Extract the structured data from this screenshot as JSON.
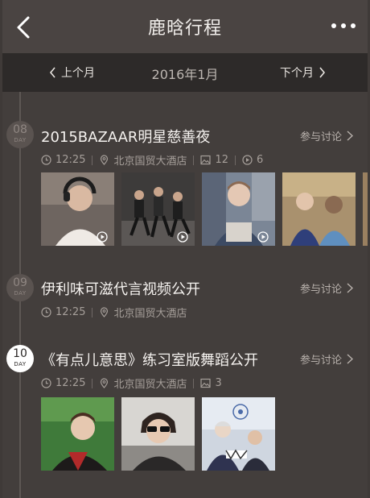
{
  "header": {
    "title": "鹿晗行程",
    "back_icon": "chevron-left-icon",
    "more_icon": "more-dots-icon"
  },
  "month_nav": {
    "prev_label": "上个月",
    "current": "2016年1月",
    "next_label": "下个月"
  },
  "colors": {
    "background": "#433e3c",
    "titlebar": "#4a4442",
    "monthbar": "#2d2a29",
    "text_muted": "#a69f9a"
  },
  "events": [
    {
      "day": "08",
      "day_label": "DAY",
      "title": "2015BAZAAR明星慈善夜",
      "discuss": "参与讨论",
      "time": "12:25",
      "location": "北京国贸大酒店",
      "image_count": "12",
      "video_count": "6",
      "photos": [
        {
          "subject": "person-with-headphones",
          "video": true
        },
        {
          "subject": "group-dancing",
          "video": true
        },
        {
          "subject": "person-in-store",
          "video": true
        },
        {
          "subject": "two-people-in-shop",
          "video": false
        }
      ]
    },
    {
      "day": "09",
      "day_label": "DAY",
      "title": "伊利味可滋代言视频公开",
      "discuss": "参与讨论",
      "time": "12:25",
      "location": "北京国贸大酒店"
    },
    {
      "day": "10",
      "day_label": "DAY",
      "title": "《有点儿意思》练习室版舞蹈公开",
      "discuss": "参与讨论",
      "time": "12:25",
      "location": "北京国贸大酒店",
      "image_count": "3",
      "photos": [
        {
          "subject": "person-on-grass",
          "video": false
        },
        {
          "subject": "person-with-sunglasses",
          "video": false
        },
        {
          "subject": "people-at-whiteboard",
          "video": false
        }
      ]
    }
  ]
}
